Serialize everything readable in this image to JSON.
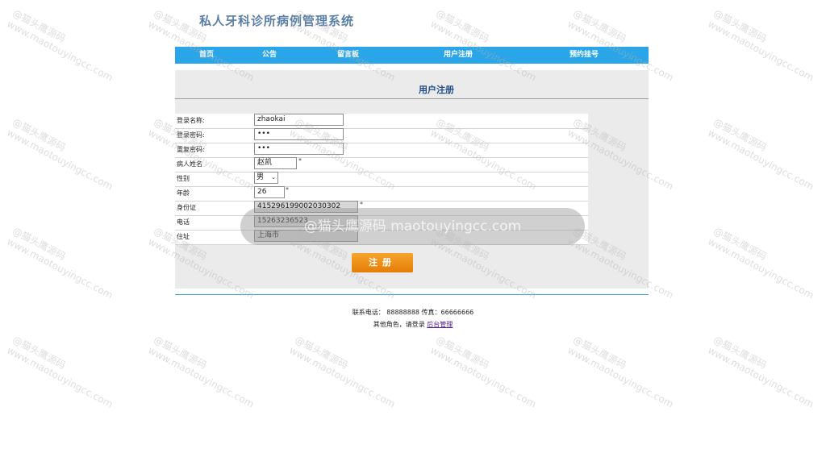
{
  "site": {
    "title": "私人牙科诊所病例管理系统"
  },
  "nav": [
    {
      "label": "首页"
    },
    {
      "label": "公告"
    },
    {
      "label": "留言板"
    },
    {
      "label": "用户注册"
    },
    {
      "label": "预约挂号"
    }
  ],
  "panel": {
    "title": "用户注册"
  },
  "form": {
    "login_name": {
      "label": "登录名称:",
      "value": "zhaokai"
    },
    "password": {
      "label": "登录密码:",
      "value": "•••"
    },
    "password_repeat": {
      "label": "重复密码:",
      "value": "•••"
    },
    "patient_name": {
      "label": "病人姓名",
      "value": "赵凯",
      "required": "*"
    },
    "gender": {
      "label": "性别",
      "value": "男",
      "chevron": "⌄"
    },
    "age": {
      "label": "年龄",
      "value": "26",
      "required": "*"
    },
    "id_card": {
      "label": "身份证",
      "value": "415296199002030302",
      "required": "*"
    },
    "phone": {
      "label": "电话",
      "value": "15263236523"
    },
    "address": {
      "label": "住址",
      "value": "上海市"
    }
  },
  "submit_label": "注册",
  "footer": {
    "contact": "联系电话： 88888888 传真：66666666",
    "other_prefix": "其他角色，请登录",
    "admin_link": "后台管理"
  },
  "watermark": {
    "banner": "@猫头鹰源码 maotouyingcc.com",
    "line1": "@猫头鹰源码",
    "line2": "www.maotouyingcc.com"
  },
  "colors": {
    "nav": "#29a5e8",
    "title": "#5b7fa6",
    "button": "#f0940e",
    "panel": "#ebebeb"
  }
}
